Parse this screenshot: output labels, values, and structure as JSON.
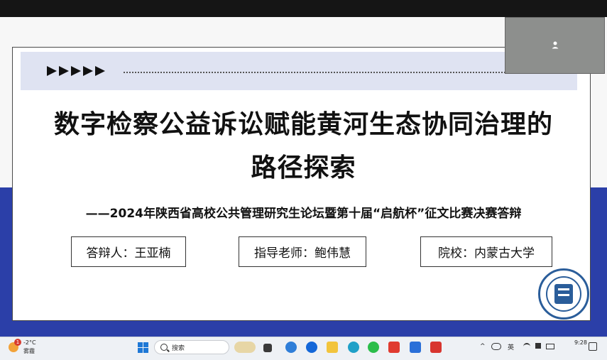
{
  "slide": {
    "title_line1": "数字检察公益诉讼赋能黄河生态协同治理的",
    "title_line2": "路径探索",
    "subtitle": "——2024年陕西省高校公共管理研究生论坛暨第十届“启航杯”征文比赛决赛答辩",
    "presenter_box": "答辩人：王亚楠",
    "advisor_box": "指导老师：鲍伟慧",
    "school_box": "院校：内蒙古大学",
    "header_arrows": 5
  },
  "video_thumbnail": {
    "icon": "person-icon"
  },
  "taskbar": {
    "weather_temp": "-2°C",
    "weather_desc": "雾霾",
    "weather_badge": "1",
    "search_placeholder": "搜索",
    "ime_label": "英",
    "clock_time": "9:28",
    "apps": [
      "file-explorer",
      "browser-edge",
      "folder",
      "chrome",
      "wechat",
      "wps",
      "meeting",
      "wps-writer"
    ]
  },
  "colors": {
    "accent_blue": "#2b3fa8",
    "header_band": "#dfe3f2",
    "seal_blue": "#2a5d9a"
  }
}
